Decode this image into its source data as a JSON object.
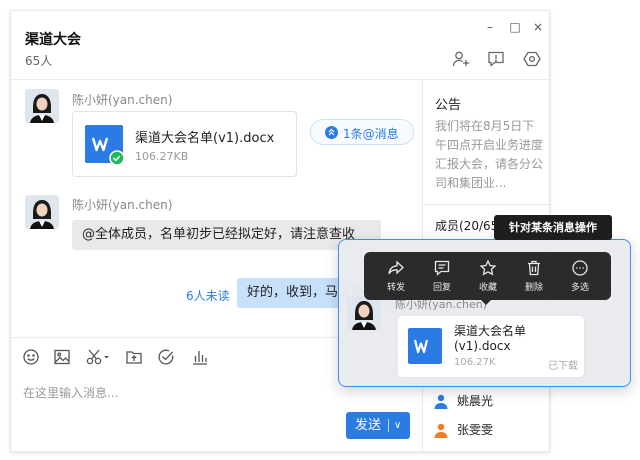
{
  "window": {
    "minimize": "–",
    "maximize": "□",
    "close": "×"
  },
  "chat": {
    "title": "渠道大会",
    "member_count": "65人"
  },
  "header_icons": [
    "add-member-icon",
    "announcement-icon",
    "settings-icon"
  ],
  "messages": [
    {
      "sender": "陈小妍(yan.chen)",
      "file": {
        "name": "渠道大会名单(v1).docx",
        "size": "106.27KB"
      }
    },
    {
      "sender": "陈小妍(yan.chen)",
      "text": "@全体成员，名单初步已经拟定好，请注意查收"
    },
    {
      "unread": "6人未读",
      "text": "好的，收到，马上处理"
    }
  ],
  "at_pill": {
    "label": "1条@消息"
  },
  "toolbar": {
    "icons": [
      "emoji-icon",
      "image-icon",
      "scissors-icon",
      "upload-folder-icon",
      "check-circle-icon",
      "chart-icon"
    ]
  },
  "input": {
    "placeholder": "在这里输入消息..."
  },
  "send": {
    "label": "发送",
    "chevron": "∨"
  },
  "sidebar": {
    "notice_title": "公告",
    "notice_body": "我们将在8月5日下午四点开启业务进度汇报大会，请各分公司和集团业...",
    "members_title": "成员(20/65)",
    "members": [
      {
        "name": "姚晨光",
        "color": "#2a7be4"
      },
      {
        "name": "张雯雯",
        "color": "#f07c2a"
      }
    ]
  },
  "callout": {
    "label": "针对某条消息操作",
    "sender": "陈小妍(yan.chen)",
    "file": {
      "name": "渠道大会名单(v1).docx",
      "size": "106.27K",
      "status": "已下载"
    },
    "actions": [
      {
        "label": "转发",
        "icon": "forward-icon"
      },
      {
        "label": "回复",
        "icon": "reply-icon"
      },
      {
        "label": "收藏",
        "icon": "star-icon"
      },
      {
        "label": "删除",
        "icon": "trash-icon"
      },
      {
        "label": "多选",
        "icon": "more-icon"
      }
    ]
  },
  "colors": {
    "accent": "#2a7be4",
    "bubble_self": "#c8e1fb",
    "bubble_other": "#e9e9e9",
    "action_bar": "#2b2b2b",
    "callout_border": "#3d8ef0",
    "doc_icon": "#2a7be4",
    "downloaded_badge": "#1fb85a"
  }
}
